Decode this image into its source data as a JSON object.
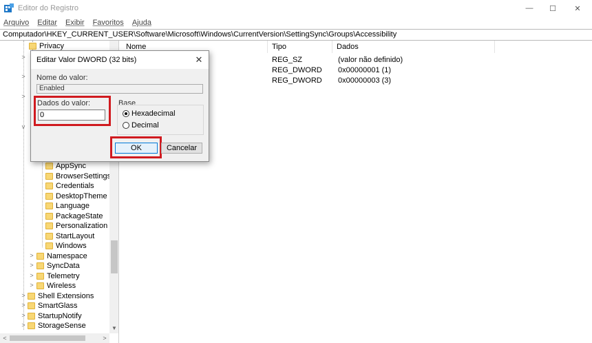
{
  "window": {
    "title": "Editor do Registro",
    "minimize_glyph": "—",
    "maximize_glyph": "☐",
    "close_glyph": "✕"
  },
  "menu": [
    "Arquivo",
    "Editar",
    "Exibir",
    "Favoritos",
    "Ajuda"
  ],
  "address_path": "Computador\\HKEY_CURRENT_USER\\Software\\Microsoft\\Windows\\CurrentVersion\\SettingSync\\Groups\\Accessibility",
  "tree": {
    "top_item": "Privacy",
    "group_children": [
      "AppSync",
      "BrowserSettings",
      "Credentials",
      "DesktopTheme",
      "Language",
      "PackageState",
      "Personalization",
      "StartLayout",
      "Windows"
    ],
    "settingsync_siblings": [
      "Namespace",
      "SyncData",
      "Telemetry",
      "Wireless"
    ],
    "level_items": [
      "Shell Extensions",
      "SmartGlass",
      "StartupNotify",
      "StorageSense"
    ]
  },
  "list": {
    "headers": {
      "name": "Nome",
      "type": "Tipo",
      "data": "Dados"
    },
    "rows": [
      {
        "type": "REG_SZ",
        "data": "(valor não definido)"
      },
      {
        "type": "REG_DWORD",
        "data": "0x00000001 (1)"
      },
      {
        "type": "REG_DWORD",
        "data": "0x00000003 (3)"
      }
    ]
  },
  "dialog": {
    "title": "Editar Valor DWORD (32 bits)",
    "close_glyph": "✕",
    "name_label": "Nome do valor:",
    "name_value": "Enabled",
    "value_label": "Dados do valor:",
    "value": "0",
    "base_label": "Base",
    "base_options": [
      {
        "label": "Hexadecimal",
        "checked": true
      },
      {
        "label": "Decimal",
        "checked": false
      }
    ],
    "ok_label": "OK",
    "cancel_label": "Cancelar"
  },
  "colors": {
    "highlight_red": "#d01a1f",
    "folder_yellow": "#f8d775",
    "ok_button_border": "#0078d7"
  }
}
